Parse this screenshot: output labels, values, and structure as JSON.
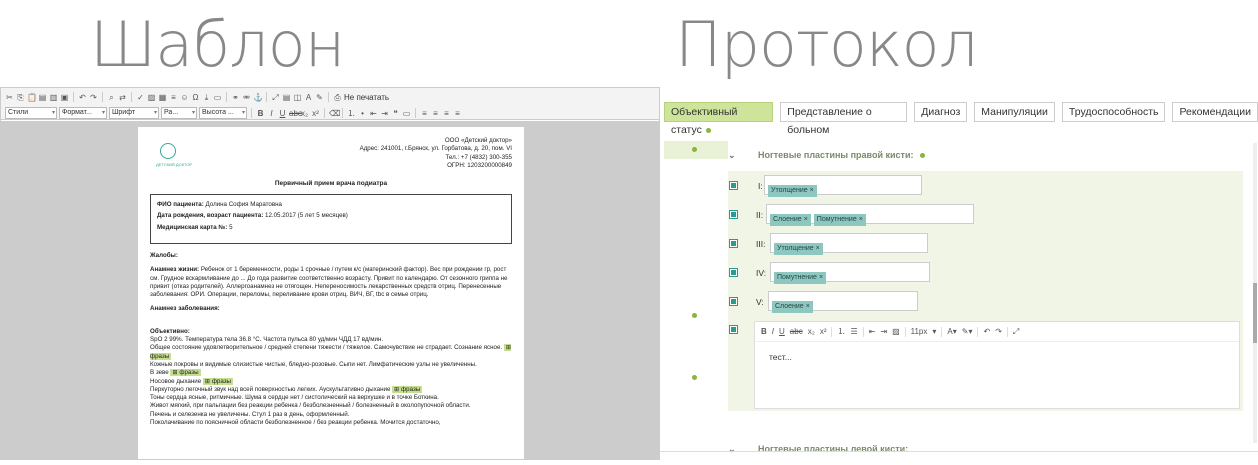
{
  "titles": {
    "left": "Шаблон",
    "right": "Протокол"
  },
  "editor": {
    "toolbar": {
      "styles": "Стили",
      "format": "Формат...",
      "font": "Шрифт",
      "size": "Ра...",
      "height": "Высота ...",
      "print": "Не печатать"
    },
    "doc": {
      "logo_text": "ДЕТСКИЙ ДОКТОР",
      "clinic": [
        "ООО «Детский доктор»",
        "Адрес: 241001, г.Брянск, ул. Горбатова, д. 20, пом. VI",
        "Тел.: +7 (4832) 300-355",
        "ОГРН: 1203200000849"
      ],
      "title": "Первичный прием врача подиатра",
      "patient_label": "ФИО пациента:",
      "patient_value": "Долина София Маратовна",
      "dob_label": "Дата рождения, возраст пациента:",
      "dob_value": "12.05.2017 (5 лет 5 месяцев)",
      "card_label": "Медицинская карта №:",
      "card_value": "5",
      "complaints": "Жалобы:",
      "anamnesis_label": "Анамнез жизни:",
      "anamnesis_text": "Ребенок от 1 беременности, роды 1 срочные / путем к/с (материнский фактор). Вес при рождении гр, рост см. Грудное вскармливание до ... До года развитие соответственно возрасту. Привит по календарю. От сезонного гриппа не привит (отказ родителей). Аллергоанамнез не отягощен. Непереносимость лекарственных средств отриц. Перенесенные заболевания: ОРИ. Операции, переломы, переливание крови отриц. ВИЧ, ВГ, tbc в семье отриц.",
      "disease_label": "Анамнез заболевания:",
      "objective_label": "Объективно:",
      "objective_line1": "SpO 2 99%. Температура тела 36.8 °C. Частота пульса 80 уд/мин ЧДД 17 вд/мин.",
      "objective_line2": "Общее состояние удовлетворительное / средней степени тяжести / тяжелое. Самочувствие не страдает. Сознание ясное.",
      "phrases": "фразы",
      "skin": "Кожные покровы и видимые слизистые чистые, бледно-розовые. Сыпи нет. Лимфатические узлы не увеличенны.",
      "zev": "В зеве",
      "nose": "Носовое дыхание",
      "lungs": "Перкуторно легочный звук над всей поверхностью легких. Аускультативно дыхание",
      "heart": "Тоны сердца ясные, ритмичные. Шума в сердце нет / систолический на верхушке и в точке Боткина.",
      "abdomen": "Живот мягкий, при пальпации без реакции ребенка / безболезненный / болезненный в околопупочной области.",
      "liver": "Печень и селезенка не увеличены. Стул 1 раз в день, оформленный.",
      "kidney": "Поколачивание по поясничной области безболезненное / без реакции ребенка. Мочится достаточно,"
    }
  },
  "protocol": {
    "tabs": [
      {
        "label": "Объективный статус",
        "active": true
      },
      {
        "label": "Представление о больном",
        "active": false
      },
      {
        "label": "Диагноз",
        "active": false
      },
      {
        "label": "Манипуляции",
        "active": false
      },
      {
        "label": "Трудоспособность",
        "active": false
      },
      {
        "label": "Рекомендации",
        "active": false
      }
    ],
    "section1": "Ногтевые пластины правой кисти:",
    "rows": [
      {
        "label": "I:",
        "tags": [
          "Утолщение"
        ]
      },
      {
        "label": "II:",
        "tags": [
          "Слоение",
          "Помутнение"
        ]
      },
      {
        "label": "III:",
        "tags": [
          "Утолщение"
        ]
      },
      {
        "label": "IV:",
        "tags": [
          "Помутнение"
        ]
      },
      {
        "label": "V:",
        "tags": [
          "Слоение"
        ]
      }
    ],
    "editor": {
      "font_size": "11px",
      "text": "тест..."
    },
    "section2": "Ногтевые пластины левой кисти:"
  },
  "colors": {
    "accent_green": "#8bb43a",
    "tab_active": "#cde49a",
    "tag": "#8ec6c0",
    "highlight": "#c6e08f"
  }
}
